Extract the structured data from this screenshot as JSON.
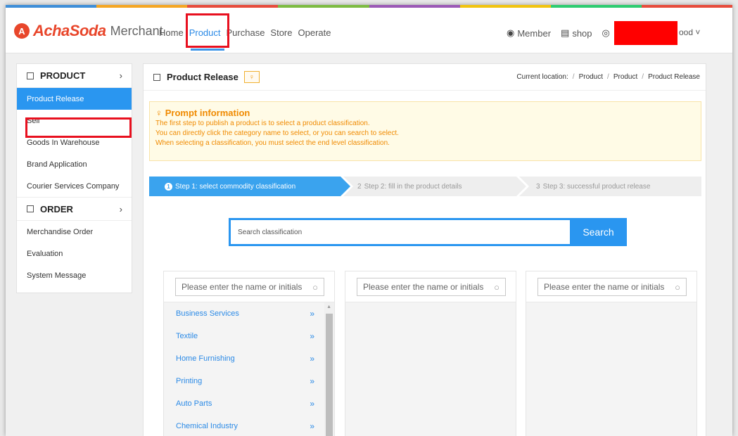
{
  "stripe_colors": [
    "#3e8ed8",
    "#f5a623",
    "#e74c3c",
    "#7dbb42",
    "#9b59b6",
    "#f1c40f",
    "#2ecc71",
    "#e74c3c"
  ],
  "header": {
    "logo_mark": "A",
    "brand": "AchaSoda",
    "merchant": "Merchant",
    "nav": [
      "Home",
      "Product",
      "Purchase",
      "Store",
      "Operate"
    ],
    "active_nav": "Product",
    "member": "Member",
    "shop": "shop",
    "user_tail": "ood ˅"
  },
  "sidebar": {
    "product_section": "PRODUCT",
    "product_items": [
      "Product Release",
      "Sell",
      "Goods In Warehouse",
      "Brand Application",
      "Courier Services Company"
    ],
    "order_section": "ORDER",
    "order_items": [
      "Merchandise Order",
      "Evaluation",
      "System Message"
    ]
  },
  "main": {
    "title": "Product Release",
    "breadcrumb": {
      "label": "Current location:",
      "items": [
        "Product",
        "Product",
        "Product Release"
      ]
    },
    "prompt": {
      "title": "Prompt information",
      "lines": [
        "The first step to publish a product is to select a product classification.",
        "You can directly click the category name to select, or you can search to select.",
        "When selecting a classification, you must select the end level classification."
      ]
    },
    "steps": [
      {
        "num": "1",
        "label": "Step 1: select commodity classification"
      },
      {
        "num": "2",
        "label": "Step 2: fill in the product details"
      },
      {
        "num": "3",
        "label": "Step 3: successful product release"
      }
    ],
    "search": {
      "placeholder": "Search classification",
      "button": "Search"
    },
    "column_placeholder": "Please enter the name or initials",
    "categories": [
      "Business Services",
      "Textile",
      "Home Furnishing",
      "Printing",
      "Auto Parts",
      "Chemical Industry"
    ]
  }
}
